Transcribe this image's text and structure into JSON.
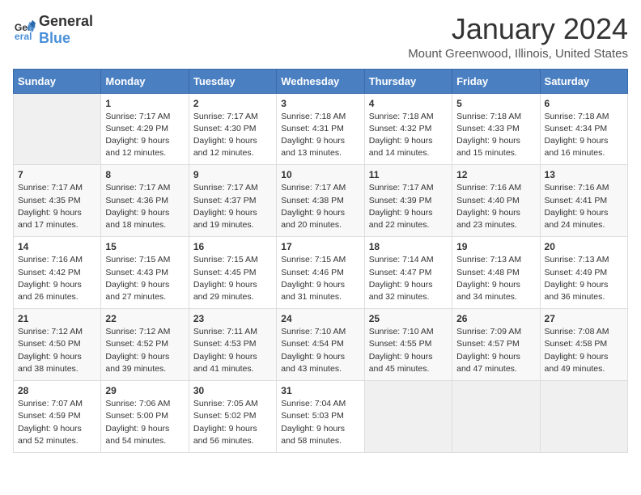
{
  "header": {
    "logo_general": "General",
    "logo_blue": "Blue",
    "title": "January 2024",
    "subtitle": "Mount Greenwood, Illinois, United States"
  },
  "days_of_week": [
    "Sunday",
    "Monday",
    "Tuesday",
    "Wednesday",
    "Thursday",
    "Friday",
    "Saturday"
  ],
  "weeks": [
    [
      {
        "day": "",
        "info": ""
      },
      {
        "day": "1",
        "info": "Sunrise: 7:17 AM\nSunset: 4:29 PM\nDaylight: 9 hours\nand 12 minutes."
      },
      {
        "day": "2",
        "info": "Sunrise: 7:17 AM\nSunset: 4:30 PM\nDaylight: 9 hours\nand 12 minutes."
      },
      {
        "day": "3",
        "info": "Sunrise: 7:18 AM\nSunset: 4:31 PM\nDaylight: 9 hours\nand 13 minutes."
      },
      {
        "day": "4",
        "info": "Sunrise: 7:18 AM\nSunset: 4:32 PM\nDaylight: 9 hours\nand 14 minutes."
      },
      {
        "day": "5",
        "info": "Sunrise: 7:18 AM\nSunset: 4:33 PM\nDaylight: 9 hours\nand 15 minutes."
      },
      {
        "day": "6",
        "info": "Sunrise: 7:18 AM\nSunset: 4:34 PM\nDaylight: 9 hours\nand 16 minutes."
      }
    ],
    [
      {
        "day": "7",
        "info": "Sunrise: 7:17 AM\nSunset: 4:35 PM\nDaylight: 9 hours\nand 17 minutes."
      },
      {
        "day": "8",
        "info": "Sunrise: 7:17 AM\nSunset: 4:36 PM\nDaylight: 9 hours\nand 18 minutes."
      },
      {
        "day": "9",
        "info": "Sunrise: 7:17 AM\nSunset: 4:37 PM\nDaylight: 9 hours\nand 19 minutes."
      },
      {
        "day": "10",
        "info": "Sunrise: 7:17 AM\nSunset: 4:38 PM\nDaylight: 9 hours\nand 20 minutes."
      },
      {
        "day": "11",
        "info": "Sunrise: 7:17 AM\nSunset: 4:39 PM\nDaylight: 9 hours\nand 22 minutes."
      },
      {
        "day": "12",
        "info": "Sunrise: 7:16 AM\nSunset: 4:40 PM\nDaylight: 9 hours\nand 23 minutes."
      },
      {
        "day": "13",
        "info": "Sunrise: 7:16 AM\nSunset: 4:41 PM\nDaylight: 9 hours\nand 24 minutes."
      }
    ],
    [
      {
        "day": "14",
        "info": "Sunrise: 7:16 AM\nSunset: 4:42 PM\nDaylight: 9 hours\nand 26 minutes."
      },
      {
        "day": "15",
        "info": "Sunrise: 7:15 AM\nSunset: 4:43 PM\nDaylight: 9 hours\nand 27 minutes."
      },
      {
        "day": "16",
        "info": "Sunrise: 7:15 AM\nSunset: 4:45 PM\nDaylight: 9 hours\nand 29 minutes."
      },
      {
        "day": "17",
        "info": "Sunrise: 7:15 AM\nSunset: 4:46 PM\nDaylight: 9 hours\nand 31 minutes."
      },
      {
        "day": "18",
        "info": "Sunrise: 7:14 AM\nSunset: 4:47 PM\nDaylight: 9 hours\nand 32 minutes."
      },
      {
        "day": "19",
        "info": "Sunrise: 7:13 AM\nSunset: 4:48 PM\nDaylight: 9 hours\nand 34 minutes."
      },
      {
        "day": "20",
        "info": "Sunrise: 7:13 AM\nSunset: 4:49 PM\nDaylight: 9 hours\nand 36 minutes."
      }
    ],
    [
      {
        "day": "21",
        "info": "Sunrise: 7:12 AM\nSunset: 4:50 PM\nDaylight: 9 hours\nand 38 minutes."
      },
      {
        "day": "22",
        "info": "Sunrise: 7:12 AM\nSunset: 4:52 PM\nDaylight: 9 hours\nand 39 minutes."
      },
      {
        "day": "23",
        "info": "Sunrise: 7:11 AM\nSunset: 4:53 PM\nDaylight: 9 hours\nand 41 minutes."
      },
      {
        "day": "24",
        "info": "Sunrise: 7:10 AM\nSunset: 4:54 PM\nDaylight: 9 hours\nand 43 minutes."
      },
      {
        "day": "25",
        "info": "Sunrise: 7:10 AM\nSunset: 4:55 PM\nDaylight: 9 hours\nand 45 minutes."
      },
      {
        "day": "26",
        "info": "Sunrise: 7:09 AM\nSunset: 4:57 PM\nDaylight: 9 hours\nand 47 minutes."
      },
      {
        "day": "27",
        "info": "Sunrise: 7:08 AM\nSunset: 4:58 PM\nDaylight: 9 hours\nand 49 minutes."
      }
    ],
    [
      {
        "day": "28",
        "info": "Sunrise: 7:07 AM\nSunset: 4:59 PM\nDaylight: 9 hours\nand 52 minutes."
      },
      {
        "day": "29",
        "info": "Sunrise: 7:06 AM\nSunset: 5:00 PM\nDaylight: 9 hours\nand 54 minutes."
      },
      {
        "day": "30",
        "info": "Sunrise: 7:05 AM\nSunset: 5:02 PM\nDaylight: 9 hours\nand 56 minutes."
      },
      {
        "day": "31",
        "info": "Sunrise: 7:04 AM\nSunset: 5:03 PM\nDaylight: 9 hours\nand 58 minutes."
      },
      {
        "day": "",
        "info": ""
      },
      {
        "day": "",
        "info": ""
      },
      {
        "day": "",
        "info": ""
      }
    ]
  ]
}
